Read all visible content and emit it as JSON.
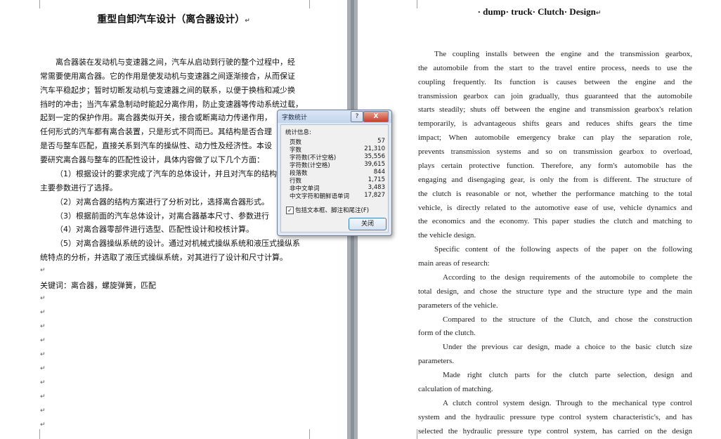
{
  "left_page": {
    "title": "重型自卸汽车设计（离合器设计）",
    "para_mark": "↵",
    "lines": [
      "离合器装在发动机与变速器之间，汽车从启动到行驶的整个过程中，经",
      "常需要使用离合器。它的作用是使发动机与变速器之间逐渐接合，从而保证",
      "汽车平稳起步；暂时切断发动机与变速器之间的联系，以便于换档和减少换",
      "挡时的冲击；当汽车紧急制动时能起分离作用，防止变速器等传动系统过载，",
      "起到一定的保护作用。离合器类似开关，接合或断离动力传递作用，",
      "任何形式的汽车都有离合装置，只是形式不同而已。其结构是否合理",
      "是否与整车匹配，直接关系到汽车的操纵性、动力性及经济性。本设",
      "要研究离合器与整车的匹配性设计，具体内容做了以下几个方面：",
      "（1）根据设计的要求完成了汽车的总体设计，并且对汽车的结构",
      "主要参数进行了选择。",
      "（2）对离合器的结构方案进行了分析对比，选择离合器形式。",
      "（3）根据前面的汽车总体设计，对离合器基本尺寸、参数进行",
      "（4）对离合器零部件进行选型、匹配性设计和校核计算。",
      "（5）对离合器操纵系统的设计。通过对机械式操纵系统和液压式操纵系",
      "统特点的分析，并选取了液压式操纵系统，对其进行了设计和尺寸计算。",
      "关键词：离合器，螺旋弹簧，匹配"
    ]
  },
  "right_page": {
    "title": "· dump· truck· Clutch· Design",
    "lines": [
      "The coupling installs between the engine and  the transmission gearbox,",
      "the automobile from the start to the travel entire process, needs to use the",
      "coupling frequently. Its function is causes between the engine and the",
      "transmission gearbox can join gradually, thus guaranteed that  the automobile",
      "starts steadily; shuts off between the engine and transmission gearbox's relation",
      "temporarily, is advantageous shifts gears and reduces shifts gears the time",
      "impact; When automobile emergency brake can play the separation role,",
      "prevents transmission systems and so on transmission gearbox to overload,",
      "plays certain protective function. Therefore, any form's automobile has the",
      "engaging and disengaging gear, is only the from is different. The structure of",
      "the clutch is reasonable or not, whether the performance matching to the total",
      "vehicle, is directly related to the automotive ease of use, vehicle dynamics and",
      "the economics and the economy. This paper studies the clutch and matching to",
      "the vehicle design.",
      "Specific content of the following aspects of the paper on the following",
      "main areas of research:",
      "According to the design requirements of the automobile to complete the",
      "total design, and chose the structure type and the structure type and the main",
      "parameters of the vehicle.",
      "Compared to the structure of the Clutch, and chose the construction",
      "form of the clutch.",
      "Under the previous car design, made a choice to the basic clutch size",
      "parameters.",
      "Made right clutch parts for the clutch parte selection, design and",
      "calculation of matching.",
      "A clutch control system design. Through to the mechanical type control",
      "system and the hydraulic pressure type control system characteristic's, and has",
      "selected the hydraulic pressure type control system, has carried on the design"
    ]
  },
  "dialog": {
    "title": "字数统计",
    "help_label": "?",
    "close_label": "X",
    "section_label": "统计信息:",
    "stats": [
      {
        "label": "页数",
        "value": "57"
      },
      {
        "label": "字数",
        "value": "21,310"
      },
      {
        "label": "字符数(不计空格)",
        "value": "35,556"
      },
      {
        "label": "字符数(计空格)",
        "value": "39,615"
      },
      {
        "label": "段落数",
        "value": "844"
      },
      {
        "label": "行数",
        "value": "1,715"
      },
      {
        "label": "非中文单词",
        "value": "3,483"
      },
      {
        "label": "中文字符和朝鲜语单词",
        "value": "17,827"
      }
    ],
    "checkbox_checked": true,
    "checkbox_label": "包括文本框、脚注和尾注(F)",
    "ok_label": "关闭"
  }
}
